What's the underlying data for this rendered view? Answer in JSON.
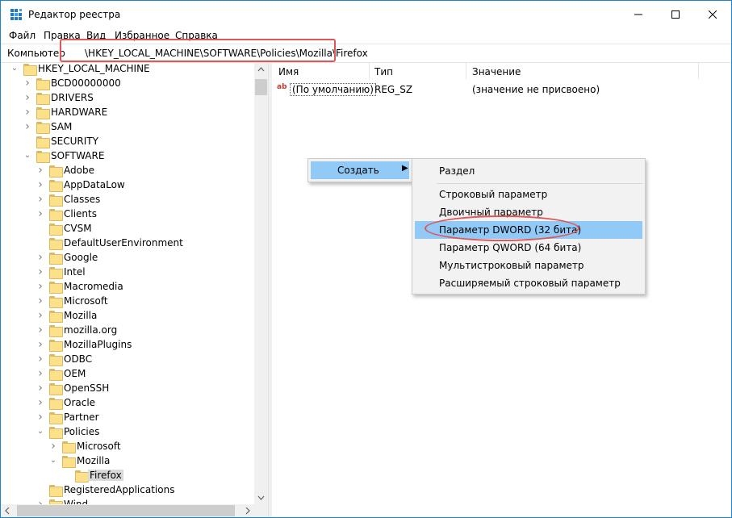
{
  "titlebar": {
    "title": "Редактор реестра"
  },
  "menu": [
    "Файл",
    "Правка",
    "Вид",
    "Избранное",
    "Справка"
  ],
  "address": {
    "label": "Компьютер",
    "path": "\\HKEY_LOCAL_MACHINE\\SOFTWARE\\Policies\\Mozilla\\Firefox"
  },
  "tree": [
    {
      "label": "HKEY_LOCAL_MACHINE",
      "depth": 1,
      "expanded": true
    },
    {
      "label": "BCD00000000",
      "depth": 2,
      "expanded": false
    },
    {
      "label": "DRIVERS",
      "depth": 2,
      "expanded": false
    },
    {
      "label": "HARDWARE",
      "depth": 2,
      "expanded": false
    },
    {
      "label": "SAM",
      "depth": 2,
      "expanded": false
    },
    {
      "label": "SECURITY",
      "depth": 2,
      "expanded": null
    },
    {
      "label": "SOFTWARE",
      "depth": 2,
      "expanded": true
    },
    {
      "label": "Adobe",
      "depth": 3,
      "expanded": false
    },
    {
      "label": "AppDataLow",
      "depth": 3,
      "expanded": false
    },
    {
      "label": "Classes",
      "depth": 3,
      "expanded": false
    },
    {
      "label": "Clients",
      "depth": 3,
      "expanded": false
    },
    {
      "label": "CVSM",
      "depth": 3,
      "expanded": null
    },
    {
      "label": "DefaultUserEnvironment",
      "depth": 3,
      "expanded": null
    },
    {
      "label": "Google",
      "depth": 3,
      "expanded": false
    },
    {
      "label": "Intel",
      "depth": 3,
      "expanded": false
    },
    {
      "label": "Macromedia",
      "depth": 3,
      "expanded": false
    },
    {
      "label": "Microsoft",
      "depth": 3,
      "expanded": false
    },
    {
      "label": "Mozilla",
      "depth": 3,
      "expanded": false
    },
    {
      "label": "mozilla.org",
      "depth": 3,
      "expanded": false
    },
    {
      "label": "MozillaPlugins",
      "depth": 3,
      "expanded": false
    },
    {
      "label": "ODBC",
      "depth": 3,
      "expanded": false
    },
    {
      "label": "OEM",
      "depth": 3,
      "expanded": false
    },
    {
      "label": "OpenSSH",
      "depth": 3,
      "expanded": false
    },
    {
      "label": "Oracle",
      "depth": 3,
      "expanded": false
    },
    {
      "label": "Partner",
      "depth": 3,
      "expanded": false
    },
    {
      "label": "Policies",
      "depth": 3,
      "expanded": true
    },
    {
      "label": "Microsoft",
      "depth": 4,
      "expanded": false
    },
    {
      "label": "Mozilla",
      "depth": 4,
      "expanded": true
    },
    {
      "label": "Firefox",
      "depth": 5,
      "expanded": null,
      "selected": true
    },
    {
      "label": "RegisteredApplications",
      "depth": 3,
      "expanded": null
    },
    {
      "label": "Wind",
      "depth": 3,
      "expanded": false
    }
  ],
  "list": {
    "columns": [
      "Имя",
      "Тип",
      "Значение"
    ],
    "rows": [
      {
        "name": "(По умолчанию)",
        "type": "REG_SZ",
        "value": "(значение не присвоено)"
      }
    ]
  },
  "context_menu": {
    "parent_item": "Создать",
    "submenu": [
      "Раздел",
      "Строковый параметр",
      "Двоичный параметр",
      "Параметр DWORD (32 бита)",
      "Параметр QWORD (64 бита)",
      "Мультистроковый параметр",
      "Расширяемый строковый параметр"
    ],
    "highlighted": "Параметр DWORD (32 бита)"
  },
  "colors": {
    "accent": "#1883d7",
    "highlight": "#91c9f7",
    "annotation": "#e05555",
    "folder": "#fde08a"
  }
}
